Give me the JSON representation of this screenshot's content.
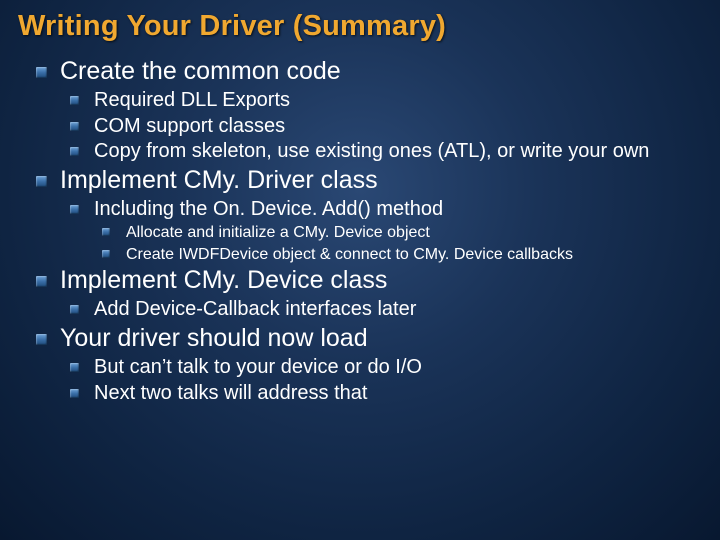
{
  "title": "Writing Your Driver (Summary)",
  "items": [
    {
      "level": 1,
      "text": "Create the common code"
    },
    {
      "level": 2,
      "text": "Required DLL Exports"
    },
    {
      "level": 2,
      "text": "COM support classes"
    },
    {
      "level": 2,
      "text": "Copy from skeleton, use existing ones (ATL), or write your own"
    },
    {
      "level": 1,
      "text": "Implement CMy. Driver class"
    },
    {
      "level": 2,
      "text": "Including the On. Device. Add() method"
    },
    {
      "level": 3,
      "text": "Allocate and initialize a CMy. Device object"
    },
    {
      "level": 3,
      "text": "Create IWDFDevice object & connect to CMy. Device callbacks"
    },
    {
      "level": 1,
      "text": "Implement CMy. Device class"
    },
    {
      "level": 2,
      "text": "Add Device-Callback interfaces later"
    },
    {
      "level": 1,
      "text": "Your driver should now load"
    },
    {
      "level": 2,
      "text": "But can’t talk to your device or do I/O"
    },
    {
      "level": 2,
      "text": "Next two talks will address that"
    }
  ]
}
